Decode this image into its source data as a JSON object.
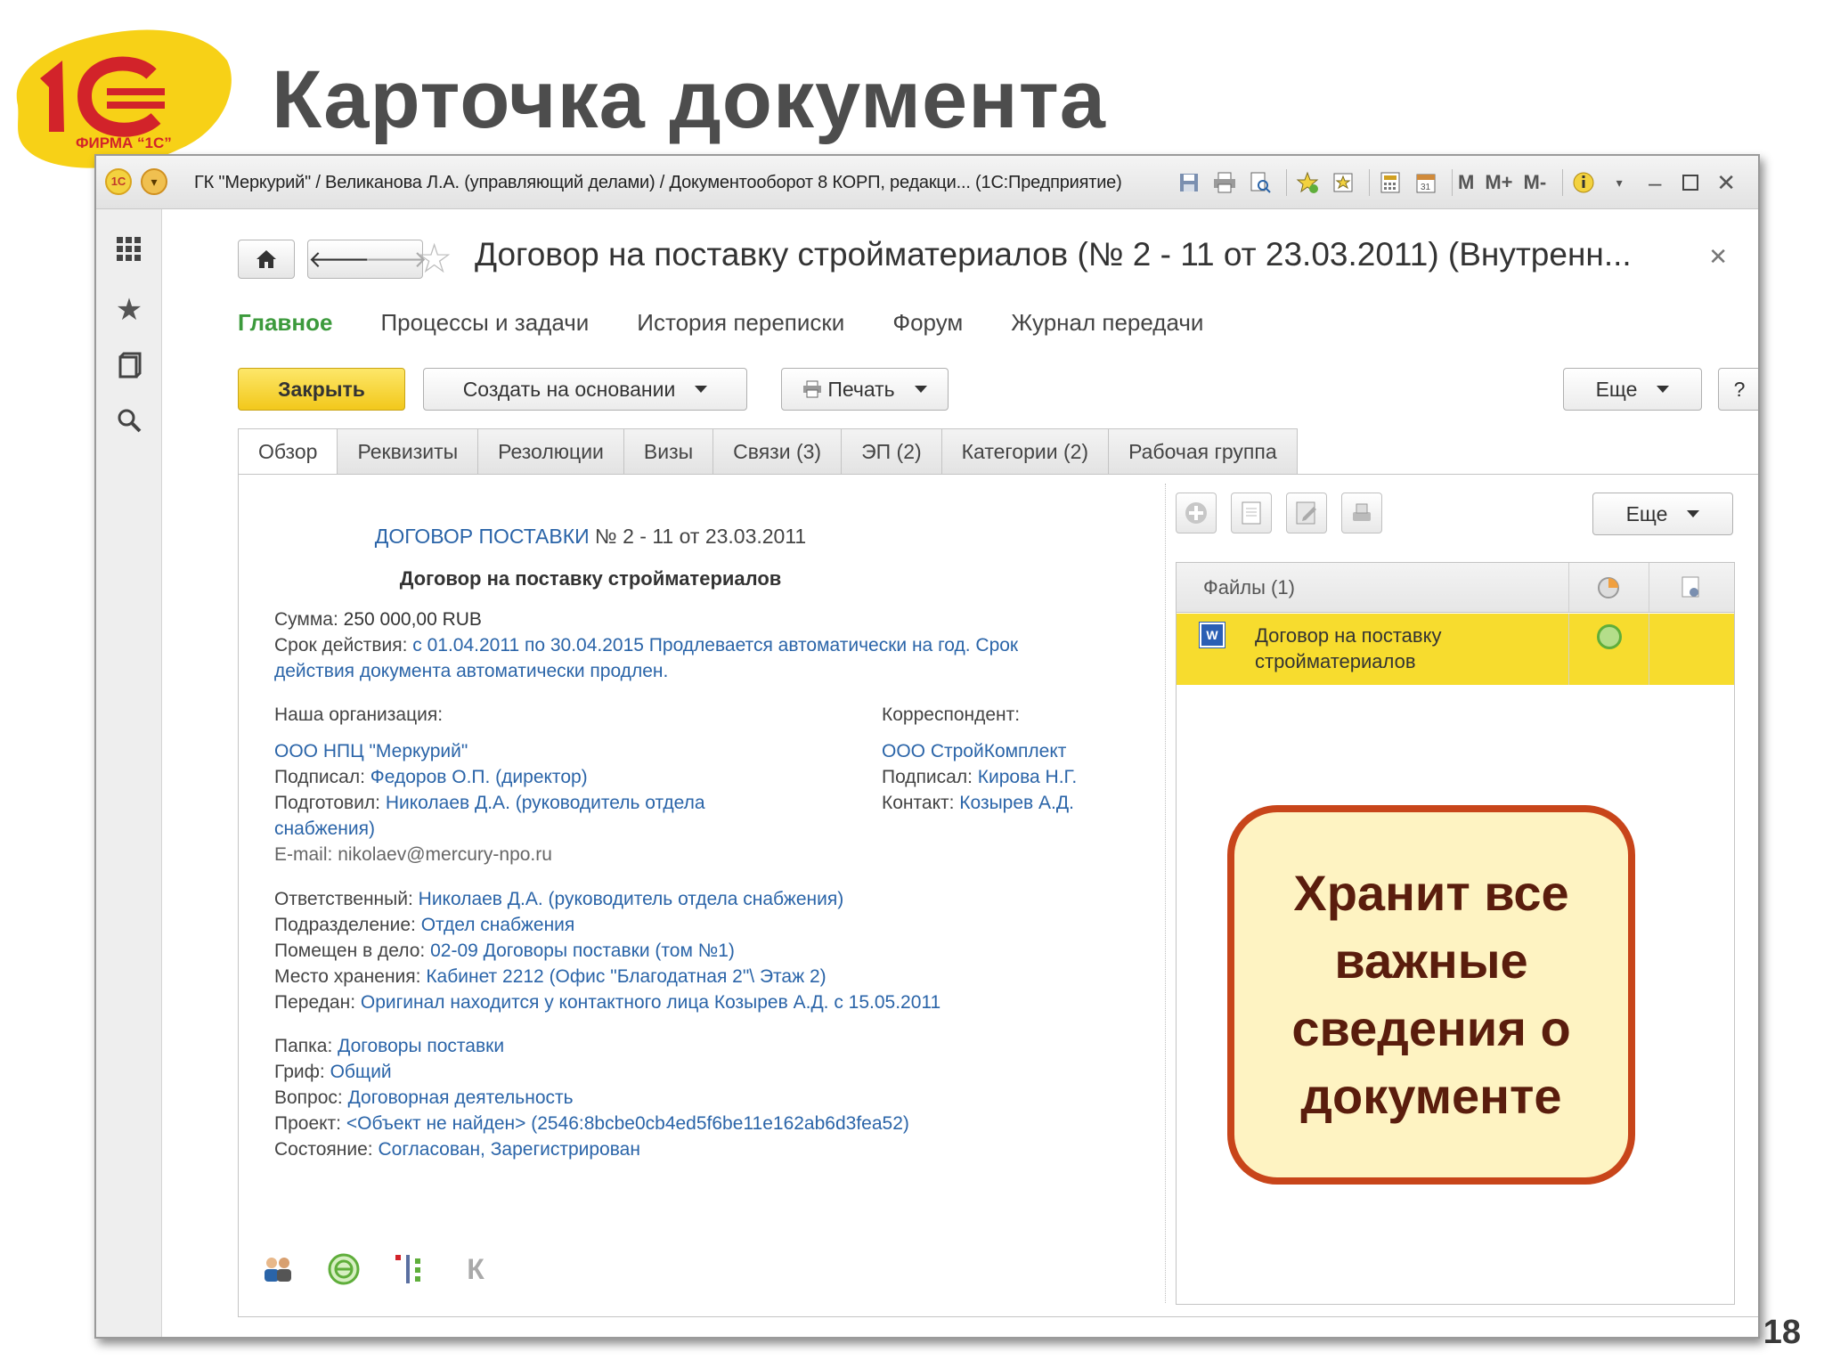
{
  "slide": {
    "title": "Карточка документа",
    "page_number": "18",
    "logo_text": "ФИРМА “1С”"
  },
  "window": {
    "title": "ГК \"Меркурий\" / Великанова Л.А. (управляющий делами) / Документооборот 8 КОРП, редакци... (1С:Предприятие)",
    "memory_buttons": [
      "M",
      "M+",
      "M-"
    ]
  },
  "document": {
    "title": "Договор на поставку стройматериалов (№ 2 - 11 от 23.03.2011) (Внутренн...",
    "sections": [
      "Главное",
      "Процессы и задачи",
      "История переписки",
      "Форум",
      "Журнал передачи"
    ],
    "active_section": "Главное"
  },
  "toolbar": {
    "close_label": "Закрыть",
    "create_based_label": "Создать на основании",
    "print_label": "Печать",
    "more_label": "Еще",
    "help_label": "?"
  },
  "tabs": [
    "Обзор",
    "Реквизиты",
    "Резолюции",
    "Визы",
    "Связи (3)",
    "ЭП (2)",
    "Категории (2)",
    "Рабочая группа"
  ],
  "overview": {
    "doc_kind_link": "ДОГОВОР ПОСТАВКИ",
    "doc_number": " № 2 - 11 от 23.03.2011",
    "subject": "Договор на поставку стройматериалов",
    "sum_label": "Сумма: ",
    "sum_value": "250 000,00 RUB",
    "term_label": "Срок действия: ",
    "term_value_line1": "с 01.04.2011 по 30.04.2015 Продлевается автоматически на год. Срок",
    "term_value_line2": "действия документа автоматически продлен.",
    "our_org_label": "Наша организация:",
    "our_org": "ООО НПЦ \"Меркурий\"",
    "signed_label": "Подписал: ",
    "our_signed": "Федоров О.П. (директор)",
    "prepared_label": "Подготовил: ",
    "prepared_line1": "Николаев Д.А. (руководитель отдела",
    "prepared_line2": "снабжения)",
    "email_label": "E-mail: ",
    "email": "nikolaev@mercury-npo.ru",
    "correspondent_label": "Корреспондент:",
    "correspondent": "ООО СтройКомплект",
    "corr_signed": "Кирова Н.Г.",
    "contact_label": "Контакт: ",
    "contact": "Козырев А.Д.",
    "responsible_label": "Ответственный: ",
    "responsible": "Николаев Д.А. (руководитель отдела снабжения)",
    "department_label": "Подразделение: ",
    "department": "Отдел снабжения",
    "case_label": "Помещен в дело: ",
    "case": "02-09 Договоры поставки (том №1)",
    "storage_label": "Место хранения: ",
    "storage": "Кабинет 2212 (Офис \"Благодатная 2\"\\ Этаж 2)",
    "handed_label": "Передан: ",
    "handed": "Оригинал находится у контактного лица Козырев А.Д. с 15.05.2011",
    "folder_label": "Папка: ",
    "folder": "Договоры поставки",
    "stamp_label": "Гриф: ",
    "stamp": "Общий",
    "question_label": "Вопрос: ",
    "question": "Договорная деятельность",
    "project_label": "Проект: ",
    "project": "<Объект не найден> (2546:8bcbe0cb4ed5f6be11e162ab6d3fea52)",
    "state_label": "Состояние: ",
    "state": "Согласован, Зарегистрирован",
    "bottom_k": "К"
  },
  "files": {
    "more_label": "Еще",
    "header": "Файлы (1)",
    "rows": [
      {
        "name": "Договор на поставку стройматериалов",
        "icon": "word-doc-icon",
        "status": "approved"
      }
    ]
  },
  "callout": {
    "text": "Хранит все важные сведения о документе"
  },
  "colors": {
    "accent_yellow": "#f7dc2e",
    "link_blue": "#2a64a8",
    "section_green": "#3c9a3c",
    "callout_border": "#c8451a",
    "callout_bg": "#fef3c2"
  }
}
